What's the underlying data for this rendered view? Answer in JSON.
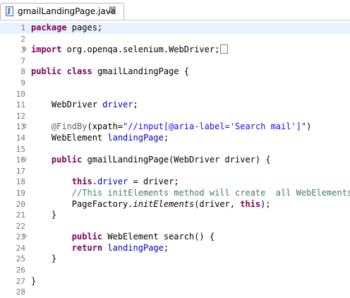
{
  "tab": {
    "filename": "gmailLandingPage.java",
    "file_icon_glyph": "J",
    "close_glyph": "⊠"
  },
  "editor": {
    "lines": [
      {
        "n": "1",
        "fold": "",
        "tokens": [
          {
            "t": "package",
            "c": "kw"
          },
          {
            "t": " pages;",
            "c": ""
          }
        ]
      },
      {
        "n": "2",
        "fold": "",
        "tokens": []
      },
      {
        "n": "3",
        "fold": "⊕",
        "tokens": [
          {
            "t": "import",
            "c": "kw"
          },
          {
            "t": " org.openqa.selenium.WebDriver;",
            "c": ""
          }
        ],
        "collapsed": true
      },
      {
        "n": "7",
        "fold": "",
        "tokens": []
      },
      {
        "n": "8",
        "fold": "",
        "tokens": [
          {
            "t": "public",
            "c": "kw"
          },
          {
            "t": " ",
            "c": ""
          },
          {
            "t": "class",
            "c": "kw"
          },
          {
            "t": " gmailLandingPage {",
            "c": ""
          }
        ]
      },
      {
        "n": "9",
        "fold": "",
        "tokens": []
      },
      {
        "n": "10",
        "fold": "",
        "tokens": []
      },
      {
        "n": "11",
        "fold": "",
        "tokens": [
          {
            "t": "    WebDriver ",
            "c": ""
          },
          {
            "t": "driver",
            "c": "fld"
          },
          {
            "t": ";",
            "c": ""
          }
        ]
      },
      {
        "n": "12",
        "fold": "",
        "tokens": []
      },
      {
        "n": "13",
        "fold": "⊖",
        "tokens": [
          {
            "t": "    @FindBy",
            "c": "ann"
          },
          {
            "t": "(xpath=",
            "c": ""
          },
          {
            "t": "\"//input[@aria-label='Search mail']\"",
            "c": "str"
          },
          {
            "t": ")",
            "c": ""
          }
        ]
      },
      {
        "n": "14",
        "fold": "",
        "tokens": [
          {
            "t": "    WebElement ",
            "c": ""
          },
          {
            "t": "landingPage",
            "c": "fld"
          },
          {
            "t": ";",
            "c": ""
          }
        ]
      },
      {
        "n": "15",
        "fold": "",
        "tokens": []
      },
      {
        "n": "16",
        "fold": "⊖",
        "tokens": [
          {
            "t": "    ",
            "c": ""
          },
          {
            "t": "public",
            "c": "kw"
          },
          {
            "t": " gmailLandingPage(WebDriver driver) {",
            "c": ""
          }
        ]
      },
      {
        "n": "17",
        "fold": "",
        "tokens": []
      },
      {
        "n": "18",
        "fold": "",
        "tokens": [
          {
            "t": "        ",
            "c": ""
          },
          {
            "t": "this",
            "c": "kw"
          },
          {
            "t": ".",
            "c": ""
          },
          {
            "t": "driver",
            "c": "fld"
          },
          {
            "t": " = driver;",
            "c": ""
          }
        ]
      },
      {
        "n": "19",
        "fold": "",
        "tokens": [
          {
            "t": "        ",
            "c": ""
          },
          {
            "t": "//This initElements method will create  all WebElements",
            "c": "cmt"
          }
        ]
      },
      {
        "n": "20",
        "fold": "",
        "tokens": [
          {
            "t": "        PageFactory.",
            "c": ""
          },
          {
            "t": "initElements",
            "c": "it"
          },
          {
            "t": "(driver, ",
            "c": ""
          },
          {
            "t": "this",
            "c": "kw"
          },
          {
            "t": ");",
            "c": ""
          }
        ]
      },
      {
        "n": "21",
        "fold": "",
        "tokens": [
          {
            "t": "    }",
            "c": ""
          }
        ]
      },
      {
        "n": "22",
        "fold": "",
        "tokens": []
      },
      {
        "n": "23",
        "fold": "⊖",
        "tokens": [
          {
            "t": "        ",
            "c": ""
          },
          {
            "t": "public",
            "c": "kw"
          },
          {
            "t": " WebElement search() {",
            "c": ""
          }
        ]
      },
      {
        "n": "24",
        "fold": "",
        "tokens": [
          {
            "t": "        ",
            "c": ""
          },
          {
            "t": "return",
            "c": "kw"
          },
          {
            "t": " ",
            "c": ""
          },
          {
            "t": "landingPage",
            "c": "fld"
          },
          {
            "t": ";",
            "c": ""
          }
        ]
      },
      {
        "n": "25",
        "fold": "",
        "tokens": [
          {
            "t": "    }",
            "c": ""
          }
        ]
      },
      {
        "n": "26",
        "fold": "",
        "tokens": []
      },
      {
        "n": "27",
        "fold": "",
        "tokens": [
          {
            "t": "}",
            "c": ""
          }
        ]
      },
      {
        "n": "28",
        "fold": "",
        "tokens": []
      }
    ]
  }
}
